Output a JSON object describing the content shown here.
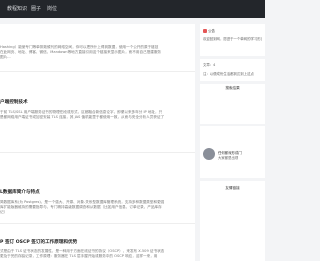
{
  "nav": {
    "items": [
      {
        "label": "教程知识"
      },
      {
        "label": "圈子"
      },
      {
        "label": "岗位"
      }
    ]
  },
  "articles": [
    {
      "title": "",
      "lines": [
        "Hashing）能使专门等单排致候刊的网络空间，你可以把所什上得到数据，使用一个公开的原于链技",
        "在此网页、地址、博客、微信、Mandown等地方直接引用这个链接来显示图片，而不用自己搭建服务",
        "图片..."
      ],
      "meta": ""
    },
    {
      "title": "户端控制技术",
      "lines": [
        "于前 TLS/SSL 用户端服务证书的物理任段或形式，区都融合新信息论字，即便以来多年分 IP 地址，只",
        "是都网络用户端证书或加密安装 TLS 连接，其 JAS 值机能里于都使用一致，从而与安全分析人员获证了"
      ],
      "meta": ""
    },
    {
      "title": "L数据库简介与特点",
      "lines": [
        "简数据库系(为 Postgres)，是一个强大、开源、对象-关系型数据库管理系统，支持多种数据类型和更强",
        "库扩能版器维持的需要指导与，专门精持高级数据调查和从数据（比如用户信息、订单记录、产品库存",
        "记）"
      ],
      "meta": ""
    },
    {
      "title": "P 签订 OSCP 签订的工作原理和优势",
      "lines": [
        "式是由于 TLS 证书状态的发展性，是一种用于方面在线证书的协议（OSCP），来发布 X.509 证书状态",
        "更及于完的存缺记录，工作原理：服务器在 TLS 层手握开始或服务中的 OSCP 响应，这样一来，用"
      ],
      "meta": ""
    }
  ],
  "sidebar": {
    "notice": {
      "title": "公告",
      "text": "欢迎回到网，愿进于一个单网的学习形式"
    },
    "stats": [
      "文章：4",
      "注：以便成份生活都到达到上这点"
    ],
    "search_head": "搜索结果",
    "list": [
      "",
      "",
      "",
      "",
      ""
    ],
    "profile": {
      "name": "任何都深形成门",
      "desc": "大家都是出现"
    },
    "links_head": "友情链接"
  }
}
